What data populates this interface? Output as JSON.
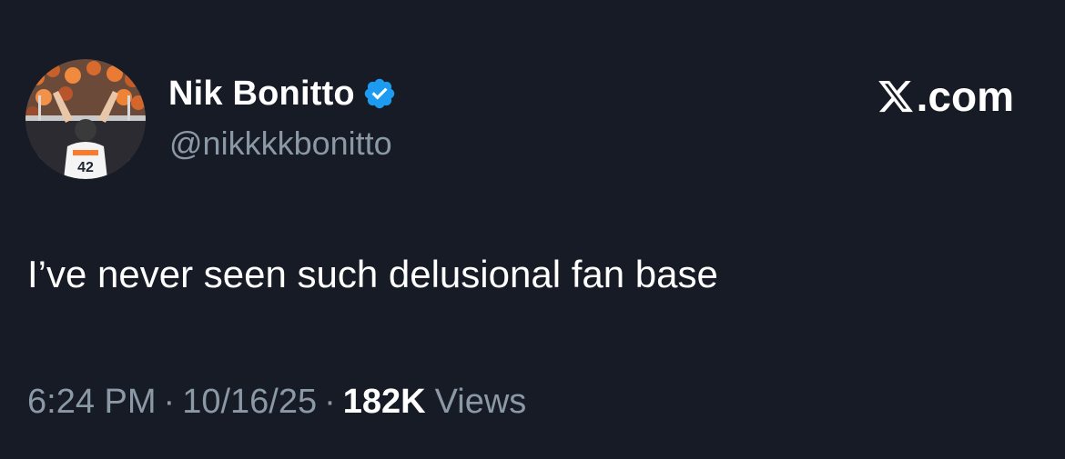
{
  "author": {
    "name": "Nik Bonitto",
    "handle": "@nikkkkbonitto",
    "verified": true,
    "avatar_icon": "profile-photo-football-player-42"
  },
  "brand": {
    "icon": "x-logo-icon",
    "text": ".com"
  },
  "tweet": {
    "text": "I’ve never seen such delusional fan base"
  },
  "meta": {
    "time": "6:24 PM",
    "separator": "·",
    "date": "10/16/25",
    "views_count": "182K",
    "views_label": "Views"
  },
  "colors": {
    "background": "#161b26",
    "text_primary": "#ffffff",
    "text_secondary": "#8b98a5",
    "verified_blue": "#1d9bf0"
  }
}
